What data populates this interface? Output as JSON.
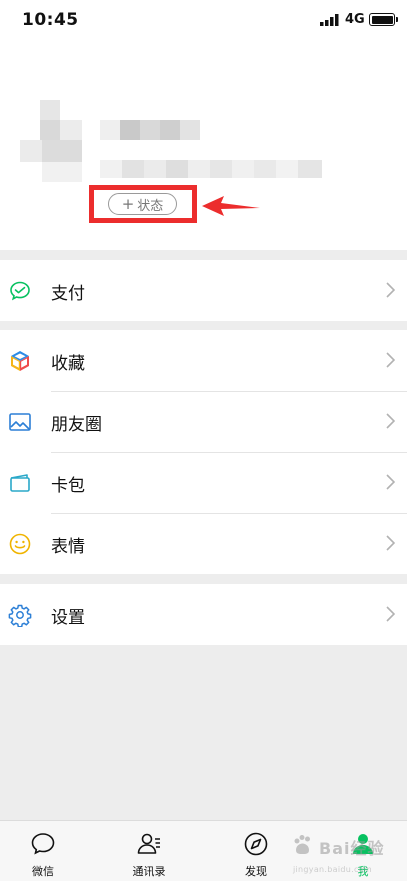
{
  "status_bar": {
    "time": "10:45",
    "network": "4G"
  },
  "profile": {
    "status_button_label": "状态"
  },
  "menu": {
    "pay": {
      "label": "支付"
    },
    "favorites": {
      "label": "收藏"
    },
    "moments": {
      "label": "朋友圈"
    },
    "cards": {
      "label": "卡包"
    },
    "stickers": {
      "label": "表情"
    },
    "settings": {
      "label": "设置"
    }
  },
  "tabbar": {
    "tabs": [
      {
        "label": "微信",
        "icon": "chat-bubble-icon"
      },
      {
        "label": "通讯录",
        "icon": "contacts-icon"
      },
      {
        "label": "发现",
        "icon": "compass-icon"
      },
      {
        "label": "我",
        "icon": "person-icon",
        "active": true
      }
    ]
  },
  "watermark": {
    "text": "Bai经验",
    "subtext": "jingyan.baidu.com"
  },
  "colors": {
    "accent_green": "#07c160",
    "highlight_red": "#ec2d2d",
    "background": "#ededed"
  }
}
